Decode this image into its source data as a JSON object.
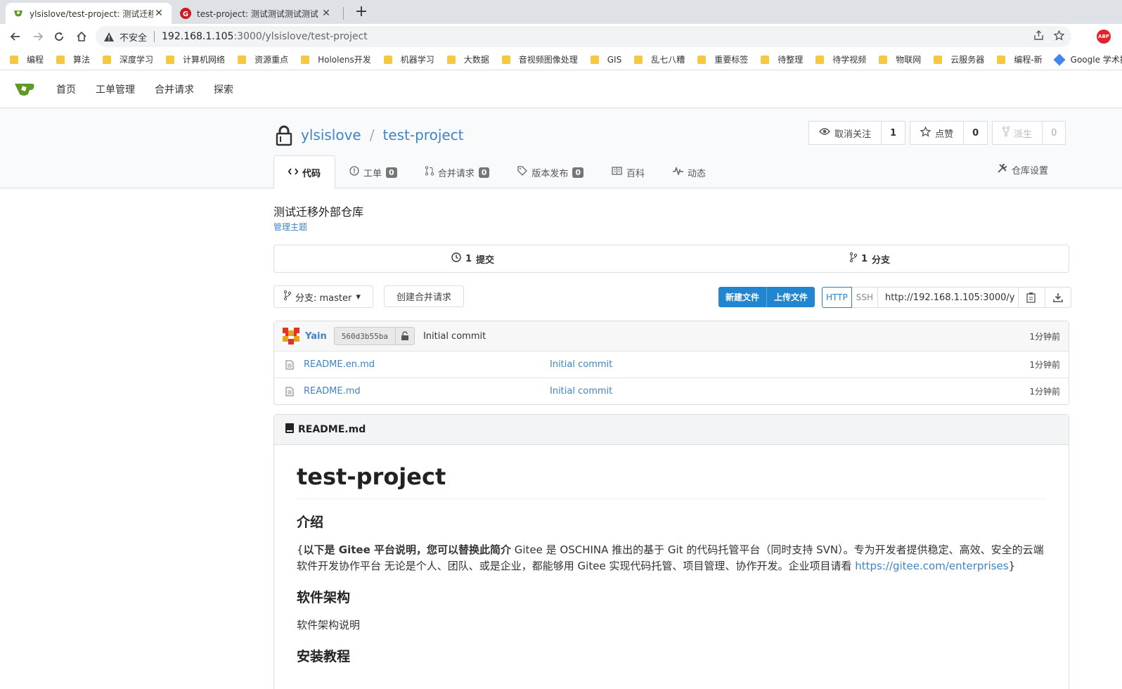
{
  "browser": {
    "tabs": [
      {
        "title": "ylsislove/test-project: 测试迁移",
        "active": true
      },
      {
        "title": "test-project: 测试测试测试测试",
        "active": false
      }
    ],
    "security_label": "不安全",
    "url_host": "192.168.1.105",
    "url_path": ":3000/ylsislove/test-project",
    "abp_label": "ABP",
    "bookmarks": [
      "编程",
      "算法",
      "深度学习",
      "计算机网络",
      "资源重点",
      "Hololens开发",
      "机器学习",
      "大数据",
      "音视频图像处理",
      "GIS",
      "乱七八糟",
      "重要标签",
      "待整理",
      "待学视频",
      "物联网",
      "云服务器",
      "编程-新",
      "Google 学术搜索"
    ]
  },
  "nav": {
    "items": [
      "首页",
      "工单管理",
      "合并请求",
      "探索"
    ]
  },
  "repo": {
    "owner": "ylsislove",
    "name": "test-project",
    "watch_label": "取消关注",
    "watch_count": "1",
    "star_label": "点赞",
    "star_count": "0",
    "fork_label": "派生",
    "fork_count": "0",
    "tabs": [
      {
        "label": "代码",
        "badge": ""
      },
      {
        "label": "工单",
        "badge": "0"
      },
      {
        "label": "合并请求",
        "badge": "0"
      },
      {
        "label": "版本发布",
        "badge": "0"
      },
      {
        "label": "百科",
        "badge": ""
      },
      {
        "label": "动态",
        "badge": ""
      }
    ],
    "settings_label": "仓库设置",
    "description": "测试迁移外部仓库",
    "manage_topics": "管理主题",
    "commits_count": "1",
    "commits_label": "提交",
    "branches_count": "1",
    "branches_label": "分支",
    "branch_label": "分支: master",
    "create_pr_label": "创建合并请求",
    "new_file_label": "新建文件",
    "upload_file_label": "上传文件",
    "http_label": "HTTP",
    "ssh_label": "SSH",
    "clone_url": "http://192.168.1.105:3000/y"
  },
  "latest_commit": {
    "author": "Yain",
    "sha": "560d3b55ba",
    "message": "Initial commit",
    "time": "1分钟前"
  },
  "files": [
    {
      "name": "README.en.md",
      "commit": "Initial commit",
      "time": "1分钟前"
    },
    {
      "name": "README.md",
      "commit": "Initial commit",
      "time": "1分钟前"
    }
  ],
  "readme": {
    "filename": "README.md",
    "h1": "test-project",
    "h2_intro": "介绍",
    "intro_open": "{",
    "intro_bold": "以下是 Gitee 平台说明，您可以替换此简介",
    "intro_text": " Gitee 是 OSCHINA 推出的基于 Git 的代码托管平台（同时支持 SVN）。专为开发者提供稳定、高效、安全的云端软件开发协作平台 无论是个人、团队、或是企业，都能够用 Gitee 实现代码托管、项目管理、协作开发。企业项目请看 ",
    "intro_link": "https://gitee.com/enterprises",
    "intro_close": "}",
    "h2_arch": "软件架构",
    "arch_text": "软件架构说明",
    "h2_install": "安装教程"
  }
}
